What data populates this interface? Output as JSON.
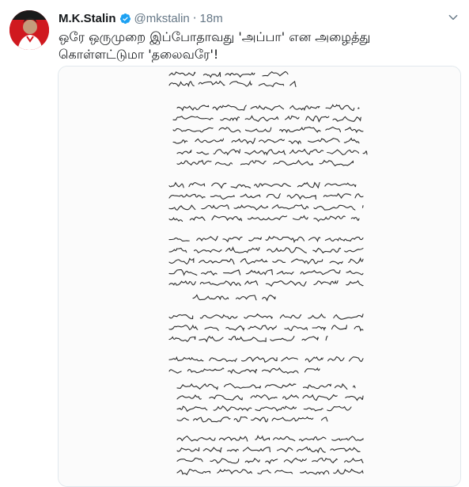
{
  "tweet": {
    "author_name": "M.K.Stalin",
    "handle": "@mkstalin",
    "separator": "·",
    "time": "18m",
    "text_line1": "ஒரே ஒருமுறை இப்போதாவது 'அப்பா' என அழைத்து",
    "text_line2": "கொள்ளட்டுமா 'தலைவரே'!",
    "verified_icon": "verified-badge-icon",
    "menu_icon": "chevron-down-icon",
    "accent_color": "#1da1f2"
  },
  "media": {
    "description_icon": "handwritten-letter-image"
  }
}
